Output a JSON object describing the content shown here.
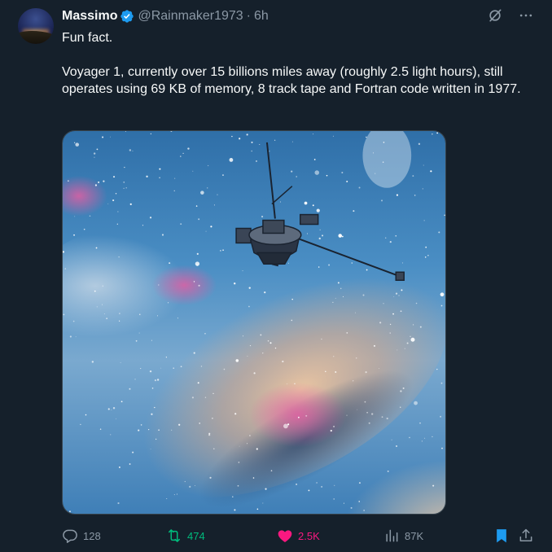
{
  "author": {
    "name": "Massimo",
    "handle": "@Rainmaker1973",
    "separator": "·",
    "time": "6h",
    "verified": true
  },
  "tweet": {
    "paragraphs": [
      "Fun fact.",
      "Voyager 1, currently over 15 billions miles away (roughly 2.5 light hours), still operates using 69 KB of memory, 8 track tape and Fortran code written in 1977."
    ]
  },
  "actions": {
    "replies": "128",
    "retweets": "474",
    "likes": "2.5K",
    "views": "87K"
  },
  "icons": {
    "grok": "grok-icon",
    "more": "more-icon",
    "reply": "reply-icon",
    "retweet": "retweet-icon",
    "like": "heart-icon",
    "views": "analytics-icon",
    "bookmark": "bookmark-icon",
    "share": "share-icon"
  },
  "colors": {
    "background": "#15202b",
    "verified": "#1d9bf0",
    "retweet_active": "#00ba7c",
    "like_active": "#f91880",
    "bookmark_active": "#1d9bf0",
    "muted": "#8b98a5"
  }
}
